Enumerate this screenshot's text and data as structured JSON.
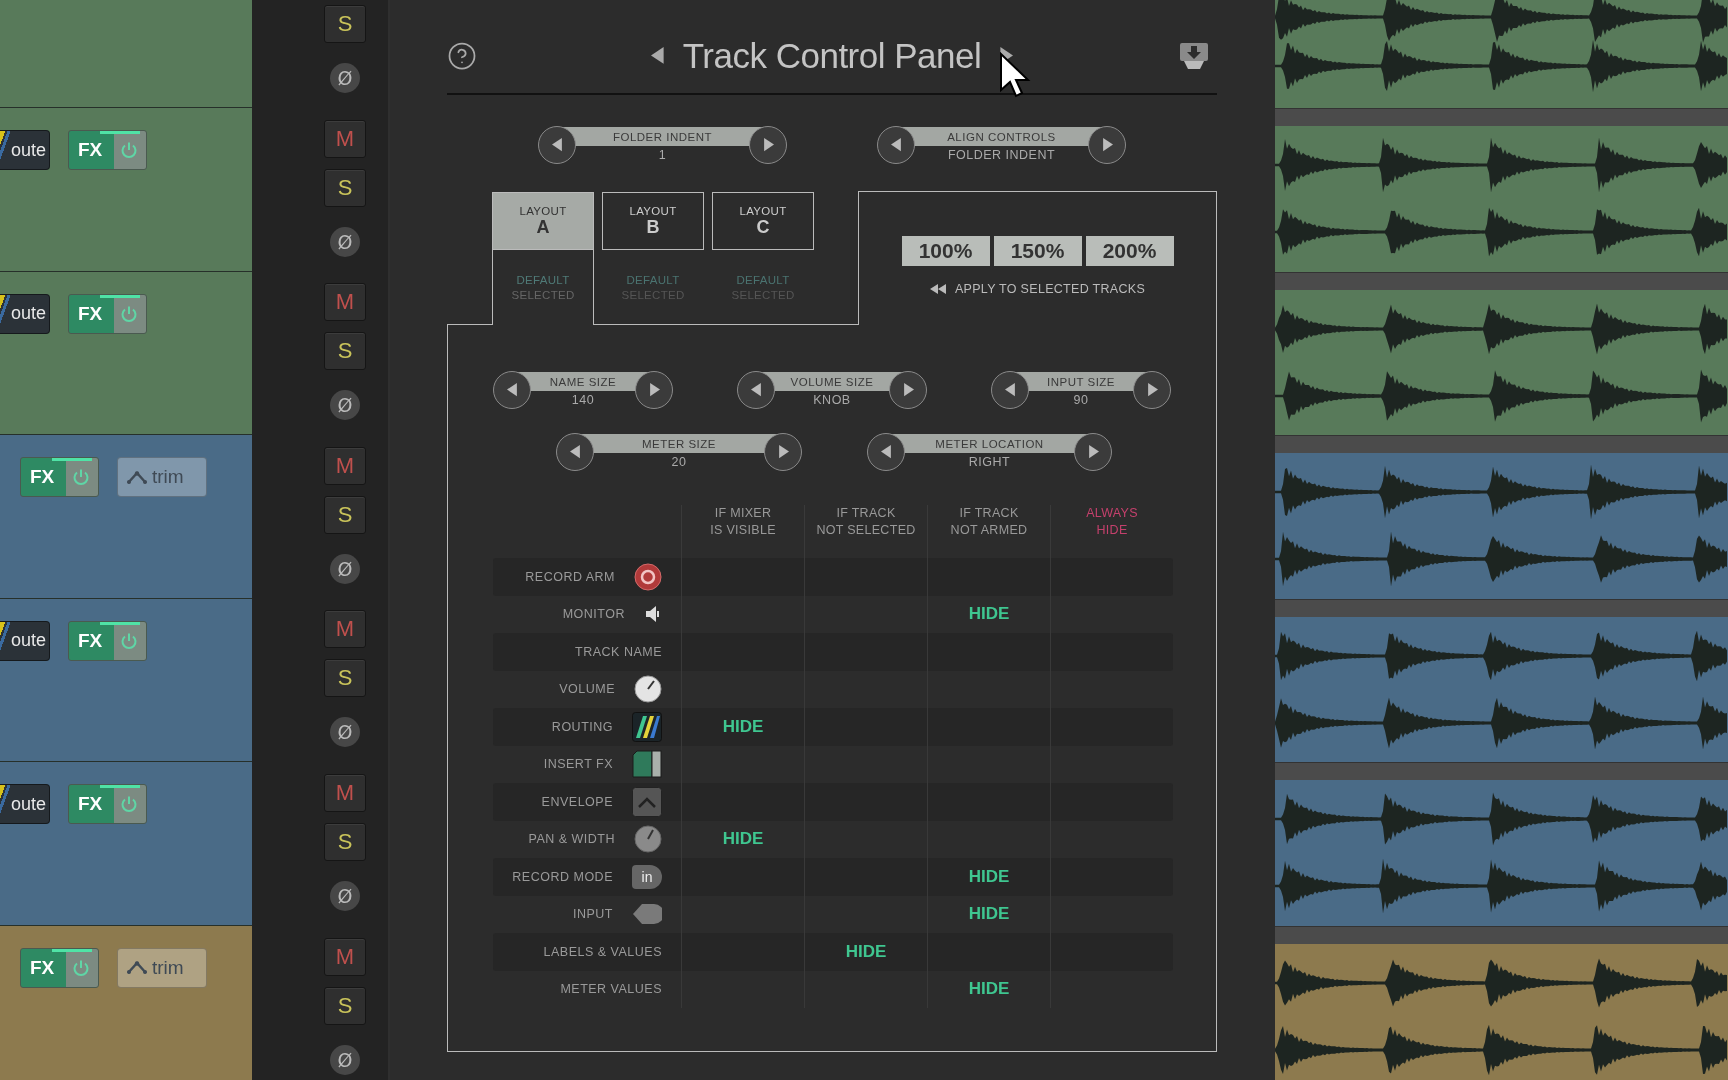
{
  "tracks": [
    {
      "color": "#587a5a",
      "mcp": {
        "solo": "S",
        "phase": "Ø"
      }
    },
    {
      "color": "#587a5a",
      "mcp": {
        "mute": "M",
        "solo": "S",
        "phase": "Ø"
      },
      "controls": [
        {
          "kind": "route",
          "label": "oute"
        },
        {
          "kind": "fx",
          "label": "FX"
        }
      ]
    },
    {
      "color": "#587a5a",
      "mcp": {
        "mute": "M",
        "solo": "S",
        "phase": "Ø"
      },
      "controls": [
        {
          "kind": "route",
          "label": "oute"
        },
        {
          "kind": "fx",
          "label": "FX"
        }
      ]
    },
    {
      "color": "#4a6b87",
      "mcp": {
        "mute": "M",
        "solo": "S",
        "phase": "Ø"
      },
      "controls": [
        {
          "kind": "fx",
          "label": "FX"
        },
        {
          "kind": "trim",
          "label": "trim"
        }
      ]
    },
    {
      "color": "#4a6b87",
      "mcp": {
        "mute": "M",
        "solo": "S",
        "phase": "Ø"
      },
      "controls": [
        {
          "kind": "route",
          "label": "oute"
        },
        {
          "kind": "fx",
          "label": "FX"
        }
      ]
    },
    {
      "color": "#4a6b87",
      "mcp": {
        "mute": "M",
        "solo": "S",
        "phase": "Ø"
      },
      "controls": [
        {
          "kind": "route",
          "label": "oute"
        },
        {
          "kind": "fx",
          "label": "FX"
        }
      ]
    },
    {
      "color": "#8d7a4e",
      "mcp": {
        "mute": "M",
        "solo": "S",
        "phase": "Ø"
      },
      "controls": [
        {
          "kind": "fx",
          "label": "FX"
        },
        {
          "kind": "trim",
          "label": "trim"
        }
      ]
    }
  ],
  "panel": {
    "title": "Track Control Panel",
    "top_spinners": [
      {
        "label": "FOLDER INDENT",
        "value": "1"
      },
      {
        "label": "ALIGN CONTROLS",
        "value": "FOLDER INDENT"
      }
    ],
    "tabs": [
      {
        "line": "LAYOUT",
        "letter": "A",
        "selected": true,
        "note": "DEFAULT",
        "status": "SELECTED"
      },
      {
        "line": "LAYOUT",
        "letter": "B",
        "selected": false,
        "note": "DEFAULT",
        "status": "SELECTED"
      },
      {
        "line": "LAYOUT",
        "letter": "C",
        "selected": false,
        "note": "DEFAULT",
        "status": "SELECTED"
      }
    ],
    "zoom": {
      "options": [
        "100%",
        "150%",
        "200%"
      ],
      "apply": "APPLY TO SELECTED TRACKS"
    },
    "spinner_rows": [
      {
        "spinners": [
          {
            "label": "NAME SIZE",
            "value": "140"
          },
          {
            "label": "VOLUME SIZE",
            "value": "KNOB"
          },
          {
            "label": "INPUT SIZE",
            "value": "90"
          }
        ]
      },
      {
        "spinners": [
          {
            "label": "METER SIZE",
            "value": "20"
          },
          {
            "label": "METER LOCATION",
            "value": "RIGHT"
          }
        ]
      }
    ],
    "visibility": {
      "columns": [
        {
          "label": "IF MIXER\nIS VISIBLE",
          "kind": "condition"
        },
        {
          "label": "IF TRACK\nNOT SELECTED",
          "kind": "condition"
        },
        {
          "label": "IF TRACK\nNOT ARMED",
          "kind": "condition"
        },
        {
          "label": "ALWAYS\nHIDE",
          "kind": "override"
        }
      ],
      "rows": [
        {
          "label": "RECORD ARM",
          "cells": [
            null,
            null,
            null,
            null
          ]
        },
        {
          "label": "MONITOR",
          "cells": [
            null,
            null,
            "HIDE",
            null
          ]
        },
        {
          "label": "TRACK NAME",
          "cells": [
            null,
            null,
            null,
            null
          ]
        },
        {
          "label": "VOLUME",
          "cells": [
            null,
            null,
            null,
            null
          ]
        },
        {
          "label": "ROUTING",
          "cells": [
            "HIDE",
            null,
            null,
            null
          ]
        },
        {
          "label": "INSERT FX",
          "cells": [
            null,
            null,
            null,
            null
          ]
        },
        {
          "label": "ENVELOPE",
          "cells": [
            null,
            null,
            null,
            null
          ]
        },
        {
          "label": "PAN & WIDTH",
          "cells": [
            "HIDE",
            null,
            null,
            null
          ]
        },
        {
          "label": "RECORD MODE",
          "icon_text": "in",
          "cells": [
            null,
            null,
            "HIDE",
            null
          ]
        },
        {
          "label": "INPUT",
          "cells": [
            null,
            null,
            "HIDE",
            null
          ]
        },
        {
          "label": "LABELS & VALUES",
          "cells": [
            null,
            "HIDE",
            null,
            null
          ]
        },
        {
          "label": "METER VALUES",
          "cells": [
            null,
            null,
            "HIDE",
            null
          ]
        }
      ]
    }
  }
}
